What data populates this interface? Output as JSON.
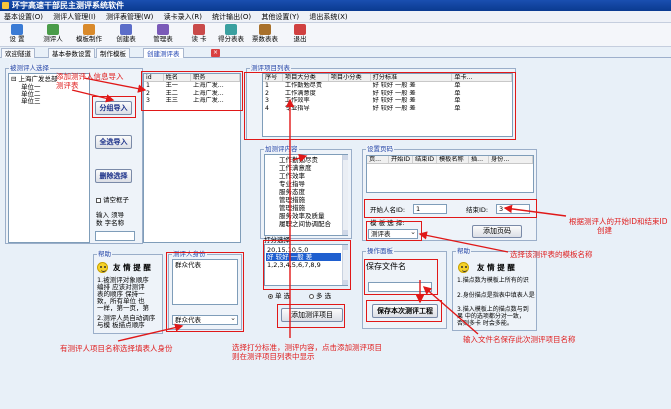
{
  "window_title": "环宇高速干部民主测评系统软件",
  "menu": [
    "基本设置(O)",
    "测评人管理(I)",
    "测评表管理(W)",
    "读卡录入(R)",
    "统计输出(O)",
    "其他设置(Y)",
    "退出系统(X)"
  ],
  "toolbar": [
    {
      "label": "设 置",
      "color": "#3a7bd5"
    },
    {
      "label": "测评人",
      "color": "#4a9c4a"
    },
    {
      "label": "模板制作",
      "color": "#d98a2b"
    },
    {
      "label": "创建表",
      "color": "#5b6dc9"
    },
    {
      "label": "管理表",
      "color": "#7a5ab8"
    },
    {
      "label": "读 卡",
      "color": "#c94a4a"
    },
    {
      "label": "得分表表",
      "color": "#3aa0a0"
    },
    {
      "label": "票数表表",
      "color": "#a8702b"
    },
    {
      "label": "退出",
      "color": "#d04040"
    }
  ],
  "tabs": [
    "欢迎隧道",
    "基本参数设置",
    "制作模板",
    "创建测评表"
  ],
  "left": {
    "caption": "被测评人选择",
    "tree_root": "上海广发总部",
    "tree_items": [
      "单位一",
      "单位二",
      "单位三"
    ]
  },
  "people": {
    "headers": [
      "id",
      "姓名",
      "职务"
    ],
    "rows": [
      [
        "1",
        "王一",
        "上海广发..."
      ],
      [
        "2",
        "王二",
        "上海广发..."
      ],
      [
        "3",
        "王三",
        "上海广发..."
      ]
    ]
  },
  "buttons": {
    "batch_import": "分组导入",
    "import_all": "全选导入",
    "delete_selected": "删除选择",
    "clear_box_label": "请空框子",
    "repeat_label_1": "输入 须导",
    "repeat_label_2": "数 字名称",
    "add_item": "添加测评项目",
    "add_template": "添加页码",
    "save_test": "保存本次测评工程"
  },
  "help_left": {
    "caption": "帮助",
    "heading": "友 情 提 醒",
    "text": [
      "1.被测评对象顺序",
      "编排 应该对测评",
      "表的顺序 保持一",
      "致，所有单位 也",
      "一样，第一页，第",
      "",
      "2.测评人员自动调序",
      "与模 板描点顺序"
    ]
  },
  "identity": {
    "caption": "测评人身份",
    "item": "群众代表",
    "dropdown": "群众代表"
  },
  "items_list": {
    "caption": "测评项目列表",
    "headers": [
      "序号",
      "项目大分类",
      "项目小分类",
      "打分标准",
      "单卡..."
    ],
    "rows": [
      [
        "1",
        "工作勤勉尽责",
        "",
        "好 较好 一般 差",
        "单"
      ],
      [
        "2",
        "工作满意度",
        "",
        "好 较好 一般 差",
        "单"
      ],
      [
        "3",
        "工作效率",
        "",
        "好 较好 一般 差",
        "单"
      ],
      [
        "4",
        "专业指导",
        "",
        "好 较好 一般 差",
        "单"
      ]
    ]
  },
  "content": {
    "caption": "加测评内容",
    "items": [
      "工作勤勉尽责",
      "工作满意度",
      "工作效率",
      "专业指导",
      "服务态度",
      "管理措施",
      "管理措施",
      "服务效率及质量",
      "履职之间协调配合"
    ]
  },
  "scoring": {
    "caption": "打分选择",
    "items": [
      "20,15,10,5,0",
      "好 较好 一般 差",
      "1,2,3,4,5,6,7,8,9"
    ],
    "radio_single": "单 选",
    "radio_multi": "多 选"
  },
  "page_setup": {
    "caption": "设置页码",
    "headers": [
      "页...",
      "开始ID",
      "结束ID",
      "模板名称",
      "插...",
      "身份..."
    ],
    "start_label": "开始人名ID:",
    "start_value": "1",
    "end_label": "结束ID:",
    "end_value": "3",
    "template_label": "模 板 选 择:",
    "template_value": "测评表"
  },
  "save_section": {
    "caption": "操作面板",
    "file_label": "保存文件名"
  },
  "help_right": {
    "caption": "帮助",
    "heading": "友 情 提 醒",
    "text": [
      "1.描点数为模板上所有的识",
      "",
      "2.身份描点是指表中填表人是",
      "",
      "3.描入模板上的描点数与到",
      "果 中的选项都分对一致，",
      "否则多卡  时会多能。"
    ]
  },
  "annotations": {
    "import": "添加测评人信息导入\n测评表",
    "identity": "有测评人项目名称选择填表人身份",
    "scoring": "选择打分标准，测评内容，点击添加测评项目\n则在测评项目列表中显示",
    "template": "选择该测评表的模板名称",
    "ids": "根据测评人的开始ID和结束ID\n创建",
    "save": "输入文件名保存此次测评项目名称"
  }
}
